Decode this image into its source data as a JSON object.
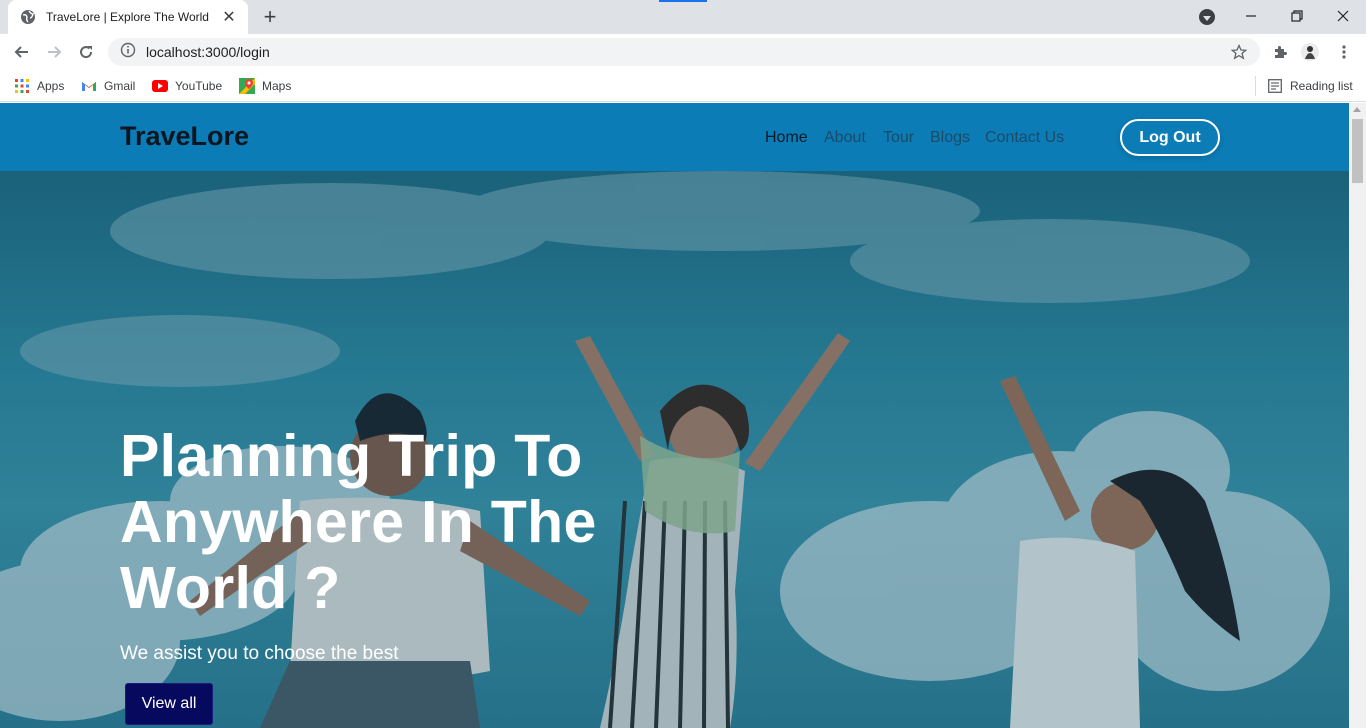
{
  "browser": {
    "tab": {
      "title": "TraveLore | Explore The World",
      "favicon": "globe-icon"
    },
    "new_tab_label": "+",
    "window_controls": [
      "minimize-icon",
      "restore-icon",
      "close-icon"
    ],
    "address_bar": {
      "url": "localhost:3000/login"
    },
    "bookmarks": [
      {
        "label": "Apps",
        "icon": "apps-grid-icon"
      },
      {
        "label": "Gmail",
        "icon": "gmail-icon"
      },
      {
        "label": "YouTube",
        "icon": "youtube-icon"
      },
      {
        "label": "Maps",
        "icon": "maps-icon"
      }
    ],
    "reading_list": "Reading list"
  },
  "site": {
    "brand": "TraveLore",
    "nav": [
      {
        "label": "Home",
        "active": true
      },
      {
        "label": "About"
      },
      {
        "label": "Tour"
      },
      {
        "label": "Blogs"
      },
      {
        "label": "Contact Us"
      }
    ],
    "logout_label": "Log Out",
    "hero": {
      "title": "Planning Trip To Anywhere In The World ?",
      "subtitle": "We assist you to choose the best",
      "cta_label": "View all"
    }
  },
  "colors": {
    "navbar": "#0b7cb6",
    "cta": "#07095e",
    "tabstrip": "#dee1e6"
  }
}
